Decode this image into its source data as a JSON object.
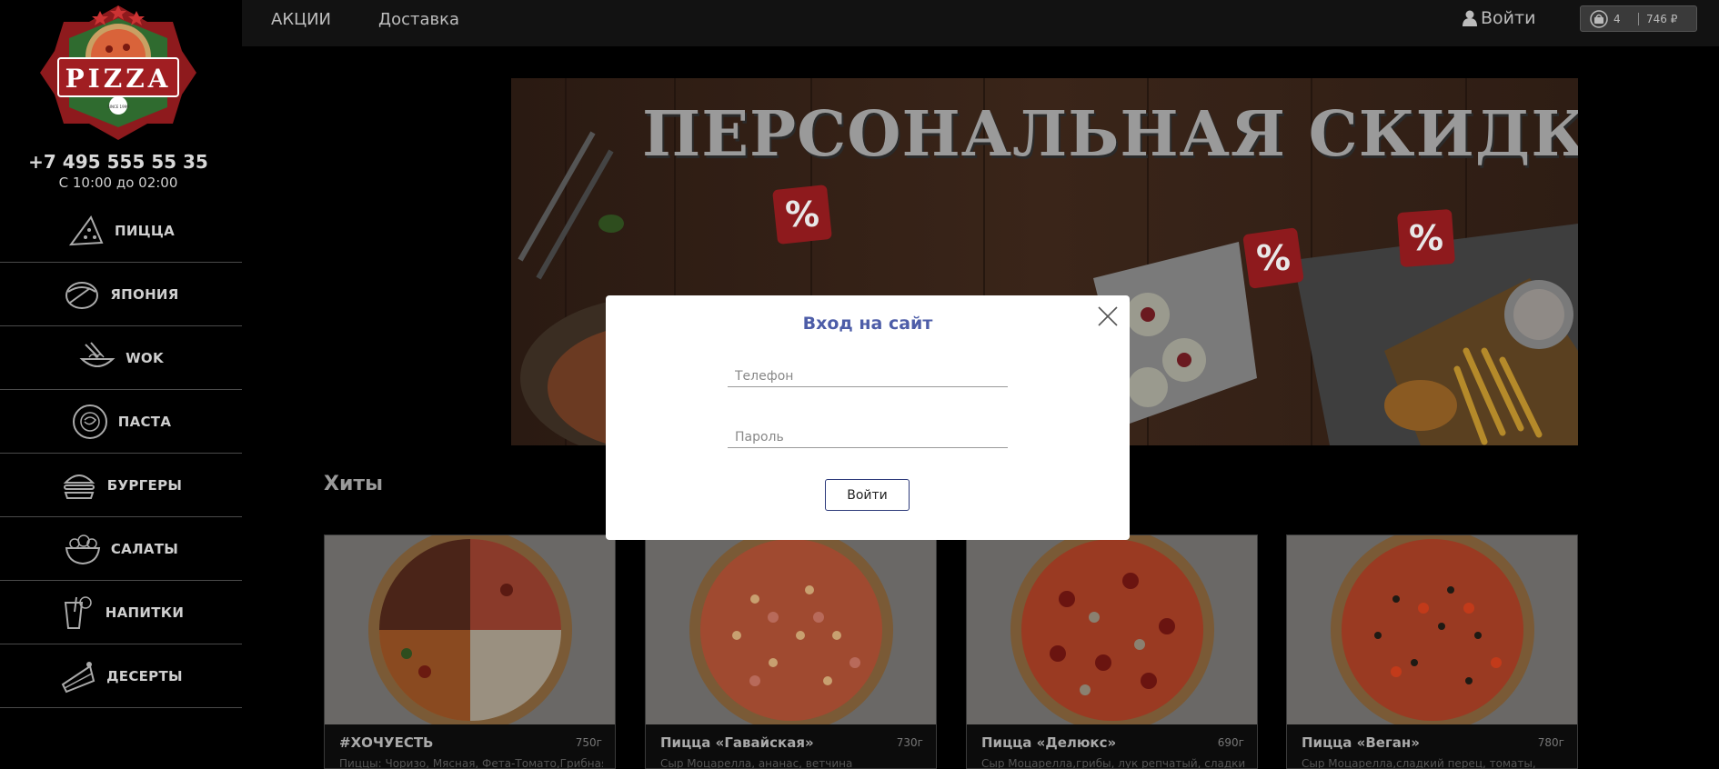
{
  "sidebar": {
    "logo_text": "PIZZA",
    "logo_small": "SINCE 1999",
    "phone": "+7 495 555 55 35",
    "hours": "С 10:00 до 02:00",
    "items": [
      {
        "label": "ПИЦЦА",
        "icon": "pizza-slice-icon"
      },
      {
        "label": "ЯПОНИЯ",
        "icon": "sushi-icon"
      },
      {
        "label": "WOK",
        "icon": "wok-noodles-icon"
      },
      {
        "label": "ПАСТА",
        "icon": "pasta-plate-icon"
      },
      {
        "label": "БУРГЕРЫ",
        "icon": "burger-icon"
      },
      {
        "label": "САЛАТЫ",
        "icon": "salad-bowl-icon"
      },
      {
        "label": "НАПИТКИ",
        "icon": "drink-glass-icon"
      },
      {
        "label": "ДЕСЕРТЫ",
        "icon": "cake-slice-icon"
      }
    ]
  },
  "topbar": {
    "nav": [
      "АКЦИИ",
      "Доставка"
    ],
    "login_label": "Войти",
    "cart_count": "4",
    "cart_sum": "746 ₽"
  },
  "banner": {
    "title": "ПЕРСОНАЛЬНАЯ СКИДКА",
    "badge": "%"
  },
  "hits": {
    "title": "Хиты",
    "products": [
      {
        "name": "#ХОЧУЕСТЬ",
        "weight": "750г",
        "desc": "Пиццы: Чоризо, Мясная, Фета-Томато,Грибная"
      },
      {
        "name": "Пицца «Гавайская»",
        "weight": "730г",
        "desc": "Сыр Моцарелла, ананас, ветчина"
      },
      {
        "name": "Пицца «Делюкс»",
        "weight": "690г",
        "desc": "Сыр Моцарелла,грибы, лук репчатый, сладкий"
      },
      {
        "name": "Пицца «Веган»",
        "weight": "780г",
        "desc": "Сыр Моцарелла,сладкий перец, томаты,"
      }
    ]
  },
  "login_modal": {
    "title": "Вход на сайт",
    "phone_placeholder": "Телефон",
    "password_placeholder": "Пароль",
    "submit_label": "Войти"
  },
  "colors": {
    "modal_title": "#4d5da8",
    "submit_border": "#2c3a7a",
    "logo_red": "#a11e22",
    "logo_green": "#2e7d32"
  }
}
